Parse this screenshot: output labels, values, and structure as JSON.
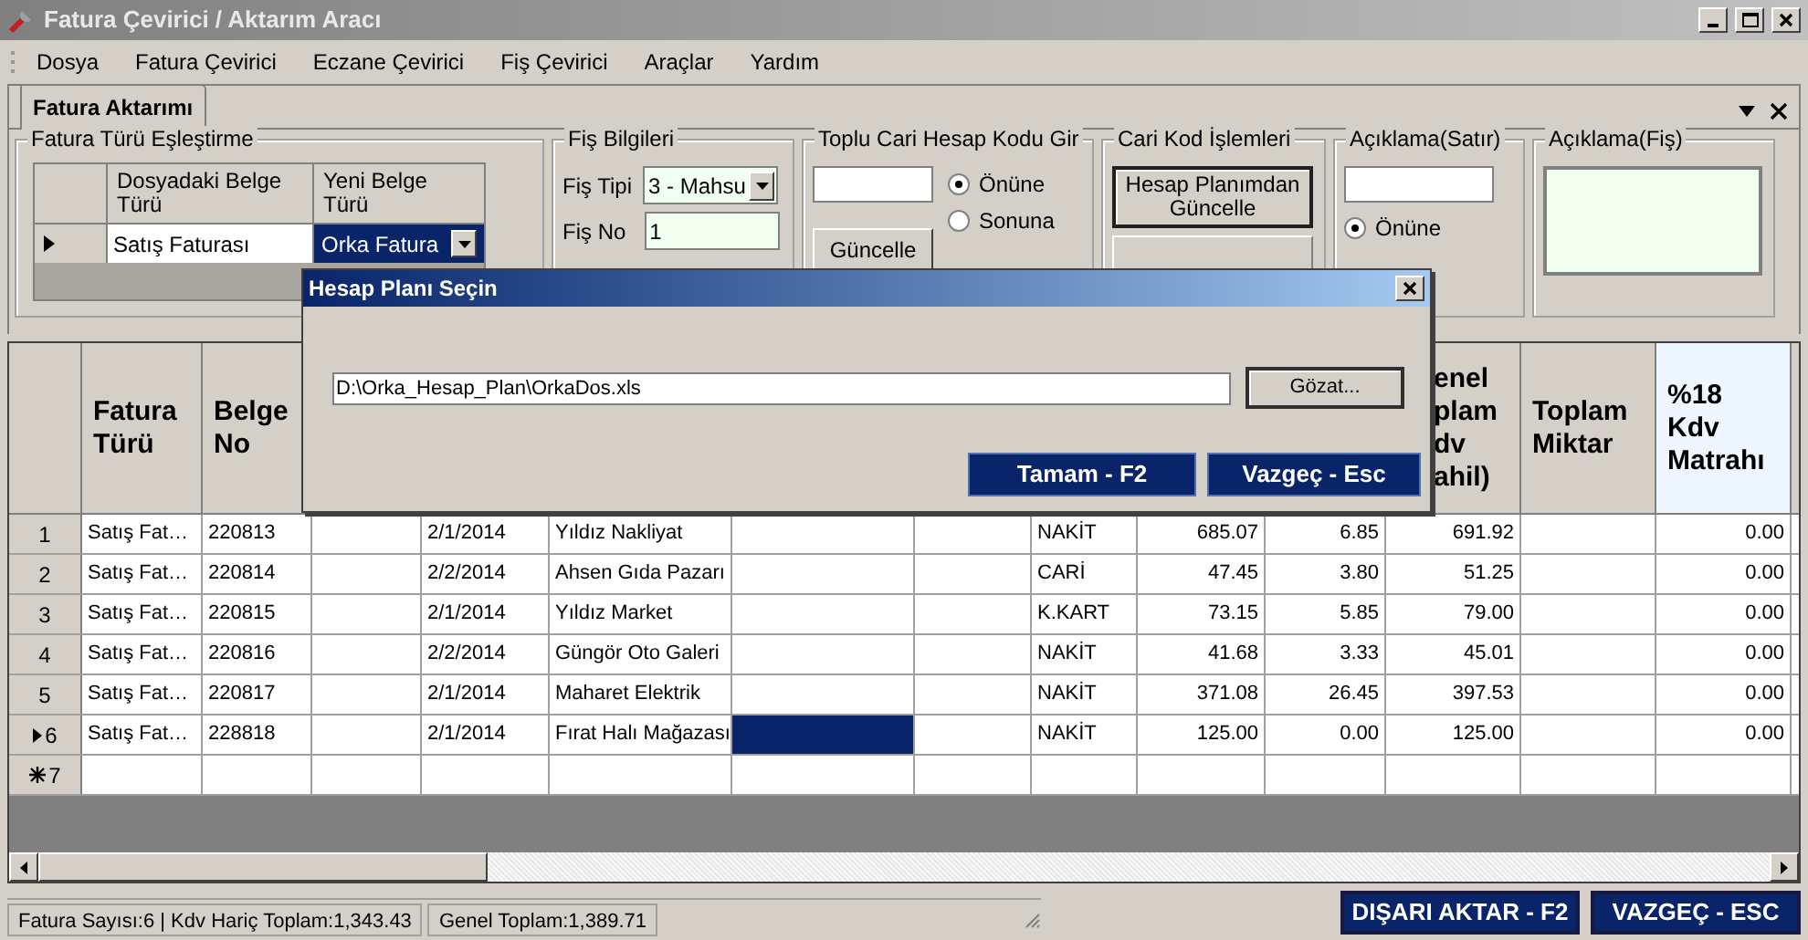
{
  "window": {
    "title": "Fatura Çevirici / Aktarım Aracı"
  },
  "menu": [
    "Dosya",
    "Fatura Çevirici",
    "Eczane Çevirici",
    "Fiş Çevirici",
    "Araçlar",
    "Yardım"
  ],
  "tabs": [
    {
      "label": "Fatura Aktarımı",
      "selected": true
    }
  ],
  "mapping": {
    "title": "Fatura Türü Eşleştirme",
    "columns": [
      "Dosyadaki Belge Türü",
      "Yeni Belge Türü"
    ],
    "rows": [
      {
        "source": "Satış Faturası",
        "target": "Orka Fatura",
        "selected": true
      }
    ]
  },
  "fis": {
    "title": "Fiş Bilgileri",
    "type_label": "Fiş Tipi",
    "type_value": "3 - Mahsu",
    "no_label": "Fiş No",
    "no_value": "1"
  },
  "toplu": {
    "title": "Toplu Cari Hesap Kodu Gir",
    "radios": [
      {
        "label": "Önüne",
        "selected": true
      },
      {
        "label": "Sonuna",
        "selected": false
      }
    ],
    "button": "Güncelle"
  },
  "cari": {
    "title": "Cari Kod İşlemleri",
    "button": "Hesap Planımdan Güncelle"
  },
  "aciklama_satir": {
    "title": "Açıklama(Satır)",
    "radios": [
      {
        "label": "Önüne",
        "selected": true
      }
    ]
  },
  "aciklama_fis": {
    "title": "Açıklama(Fiş)"
  },
  "grid": {
    "headers_left": [
      "Fatura Türü",
      "Belge No"
    ],
    "headers_right": [
      "enel\nplam\ndv\nahil)",
      "Toplam Miktar",
      "%18 Kdv Matrahı"
    ],
    "rows": [
      {
        "number": "1",
        "current": false,
        "new_row": false,
        "cells": [
          "Satış Fat…",
          "220813",
          null,
          "2/1/2014",
          "Yıldız Nakliyat",
          null,
          null,
          "NAKİT",
          "685.07",
          "6.85",
          "691.92",
          null,
          "0.00"
        ]
      },
      {
        "number": "2",
        "current": false,
        "new_row": false,
        "cells": [
          "Satış Fat…",
          "220814",
          null,
          "2/2/2014",
          "Ahsen Gıda Pazarı",
          null,
          null,
          "CARİ",
          "47.45",
          "3.80",
          "51.25",
          null,
          "0.00"
        ]
      },
      {
        "number": "3",
        "current": false,
        "new_row": false,
        "cells": [
          "Satış Fat…",
          "220815",
          null,
          "2/1/2014",
          "Yıldız Market",
          null,
          null,
          "K.KART",
          "73.15",
          "5.85",
          "79.00",
          null,
          "0.00"
        ]
      },
      {
        "number": "4",
        "current": false,
        "new_row": false,
        "cells": [
          "Satış Fat…",
          "220816",
          null,
          "2/2/2014",
          "Güngör Oto Galeri",
          null,
          null,
          "NAKİT",
          "41.68",
          "3.33",
          "45.01",
          null,
          "0.00"
        ]
      },
      {
        "number": "5",
        "current": false,
        "new_row": false,
        "cells": [
          "Satış Fat…",
          "220817",
          null,
          "2/1/2014",
          "Maharet Elektrik",
          null,
          null,
          "NAKİT",
          "371.08",
          "26.45",
          "397.53",
          null,
          "0.00"
        ]
      },
      {
        "number": "6",
        "current": true,
        "new_row": false,
        "cells": [
          "Satış Fat…",
          "228818",
          null,
          "2/1/2014",
          "Fırat Halı Mağazası",
          {
            "selected": true
          },
          null,
          "NAKİT",
          "125.00",
          "0.00",
          "125.00",
          null,
          "0.00"
        ]
      },
      {
        "number": "7",
        "current": false,
        "new_row": true,
        "cells": []
      }
    ]
  },
  "dialog": {
    "title": "Hesap Planı Seçin",
    "path": "D:\\Orka_Hesap_Plan\\OrkaDos.xls",
    "browse": "Gözat...",
    "buttons": [
      "Tamam - F2",
      "Vazgeç - Esc"
    ]
  },
  "status": [
    "Fatura Sayısı:6 | Kdv Hariç Toplam:1,343.43",
    "Genel Toplam:1,389.71"
  ],
  "actions": [
    "DIŞARI AKTAR - F2",
    "VAZGEÇ - ESC"
  ]
}
